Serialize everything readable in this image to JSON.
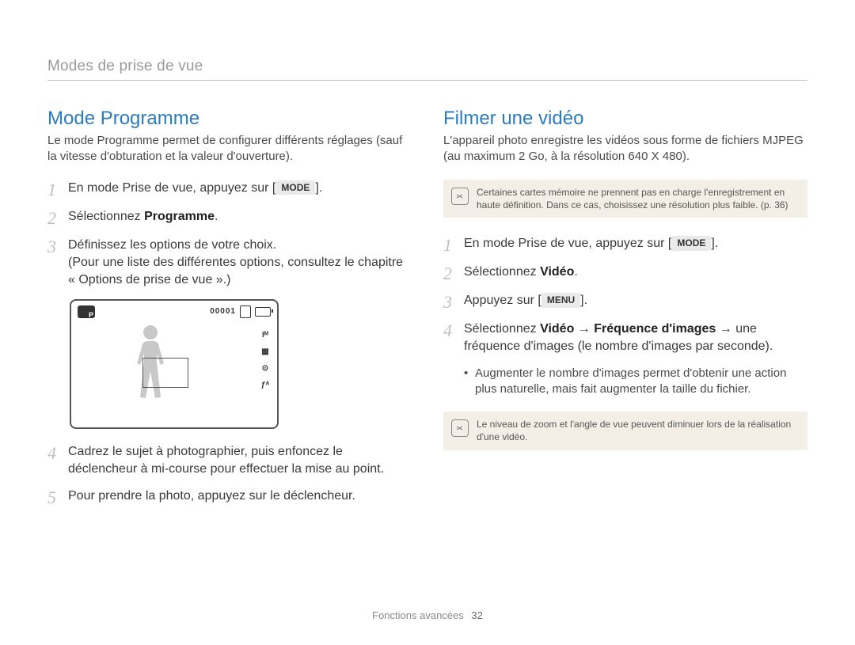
{
  "header": "Modes de prise de vue",
  "left": {
    "title": "Mode Programme",
    "intro": "Le mode Programme permet de configurer différents réglages (sauf la vitesse d'obturation et la valeur d'ouverture).",
    "steps": [
      {
        "num": "1",
        "before": "En mode Prise de vue, appuyez sur [",
        "badge": "MODE",
        "after": "]."
      },
      {
        "num": "2",
        "before": "Sélectionnez ",
        "bold": "Programme",
        "after": "."
      },
      {
        "num": "3",
        "text": "Définissez les options de votre choix.\n(Pour une liste des différentes options, consultez le chapitre « Options de prise de vue ».)"
      },
      {
        "num": "4",
        "text": "Cadrez le sujet à photographier, puis enfoncez le déclencheur à mi-course pour effectuer la mise au point."
      },
      {
        "num": "5",
        "text": "Pour prendre la photo, appuyez sur le déclencheur."
      }
    ],
    "camera": {
      "shots": "00001",
      "side": [
        "Iᴹ",
        "▦",
        "⊙",
        "ƒᴬ"
      ]
    }
  },
  "right": {
    "title": "Filmer une vidéo",
    "intro": "L'appareil photo enregistre les vidéos sous forme de fichiers MJPEG (au maximum 2 Go, à la résolution 640 X 480).",
    "note1": "Certaines cartes mémoire ne prennent pas en charge l'enregistrement en haute définition. Dans ce cas, choisissez une résolution plus faible. (p. 36)",
    "steps": [
      {
        "num": "1",
        "before": "En mode Prise de vue, appuyez sur [",
        "badge": "MODE",
        "after": "]."
      },
      {
        "num": "2",
        "before": "Sélectionnez ",
        "bold": "Vidéo",
        "after": "."
      },
      {
        "num": "3",
        "before": "Appuyez sur [",
        "badge": "MENU",
        "after": "]."
      },
      {
        "num": "4",
        "before": "Sélectionnez ",
        "bold": "Vidéo",
        "mid": " → ",
        "bold2": "Fréquence d'images",
        "after": " → une fréquence d'images (le nombre d'images par seconde)."
      }
    ],
    "bullet": "Augmenter le nombre d'images permet d'obtenir une action plus naturelle, mais fait augmenter la taille du fichier.",
    "note2": "Le niveau de zoom et l'angle de vue peuvent diminuer lors de la réalisation d'une vidéo."
  },
  "footer": {
    "label": "Fonctions avancées",
    "page": "32"
  }
}
